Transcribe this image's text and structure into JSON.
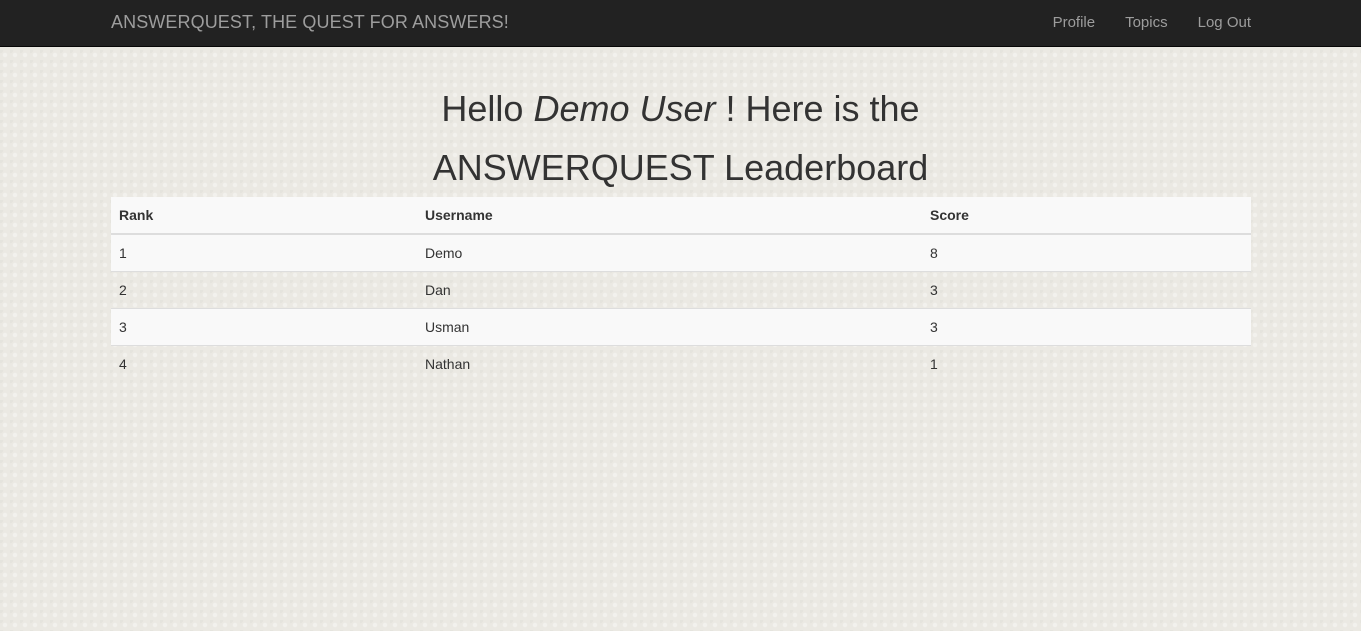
{
  "navbar": {
    "brand": "ANSWERQUEST, THE QUEST FOR ANSWERS!",
    "links": [
      {
        "label": "Profile"
      },
      {
        "label": "Topics"
      },
      {
        "label": "Log Out"
      }
    ]
  },
  "heading": {
    "prefix": "Hello ",
    "user": "Demo User",
    "suffix": " ! Here is the",
    "line2": "ANSWERQUEST Leaderboard"
  },
  "leaderboard": {
    "headers": [
      "Rank",
      "Username",
      "Score"
    ],
    "rows": [
      [
        "1",
        "Demo",
        "8"
      ],
      [
        "2",
        "Dan",
        "3"
      ],
      [
        "3",
        "Usman",
        "3"
      ],
      [
        "4",
        "Nathan",
        "1"
      ]
    ]
  },
  "colors": {
    "navbar_bg": "#222222",
    "nav_text": "#9d9d9d",
    "page_bg": "#ebe9e3",
    "stripe": "#f9f9f9"
  }
}
